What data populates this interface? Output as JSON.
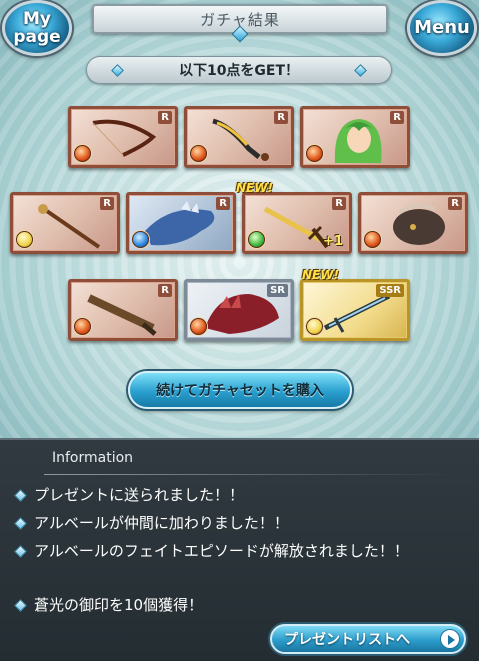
{
  "header": {
    "title": "ガチャ結果",
    "mypage_label": "My page",
    "menu_label": "Menu"
  },
  "result_banner": "以下10点をGET！",
  "cards": [
    {
      "rarity": "R",
      "element": "fire",
      "kind": "bow-weapon-icon",
      "new": false,
      "plus": ""
    },
    {
      "rarity": "R",
      "element": "fire",
      "kind": "scimitar-weapon-icon",
      "new": false,
      "plus": ""
    },
    {
      "rarity": "R",
      "element": "fire",
      "kind": "character-portrait-icon",
      "new": false,
      "plus": ""
    },
    {
      "rarity": "R",
      "element": "light",
      "kind": "staff-weapon-icon",
      "new": false,
      "plus": ""
    },
    {
      "rarity": "R",
      "element": "water",
      "kind": "dragon-summon-icon",
      "new": false,
      "plus": ""
    },
    {
      "rarity": "R",
      "element": "wind",
      "kind": "sword-weapon-icon",
      "new": true,
      "plus": "+1"
    },
    {
      "rarity": "R",
      "element": "fire",
      "kind": "beast-summon-icon",
      "new": false,
      "plus": ""
    },
    {
      "rarity": "R",
      "element": "fire",
      "kind": "gun-weapon-icon",
      "new": false,
      "plus": ""
    },
    {
      "rarity": "SR",
      "element": "fire",
      "kind": "dragon-summon-icon",
      "new": false,
      "plus": ""
    },
    {
      "rarity": "SSR",
      "element": "light",
      "kind": "sword-weapon-icon",
      "new": true,
      "plus": ""
    }
  ],
  "new_label": "NEW!",
  "buy_button_label": "続けてガチャセットを購入",
  "info": {
    "title": "Information",
    "items": [
      "プレゼントに送られました！！",
      "アルベールが仲間に加わりました！！",
      "アルベールのフェイトエピソードが解放されました！！",
      "蒼光の御印を10個獲得！"
    ],
    "present_button_label": "プレゼントリストへ"
  },
  "colors": {
    "fire": "#e0541a",
    "light": "#f0d34a",
    "water": "#2a86e0",
    "wind": "#3fb83a",
    "accent": "#2a9fcf"
  }
}
